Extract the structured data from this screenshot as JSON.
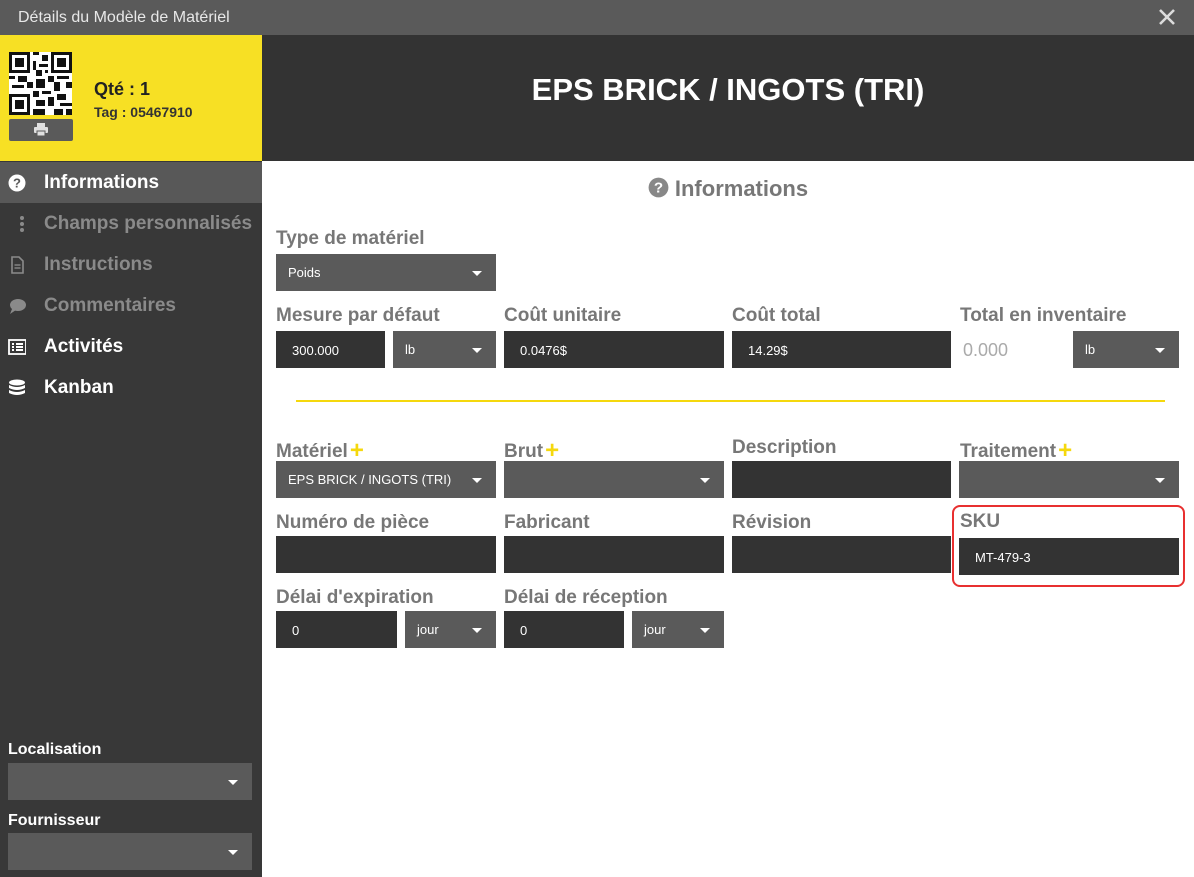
{
  "window": {
    "title": "Détails du Modèle de Matériel"
  },
  "item": {
    "qty": "Qté : 1",
    "tag": "Tag : 05467910",
    "name": "EPS BRICK / INGOTS (TRI)"
  },
  "sidebar": {
    "items": [
      {
        "label": "Informations",
        "icon": "question-circle-icon",
        "state": "active"
      },
      {
        "label": "Champs personnalisés",
        "icon": "vertical-dots-icon",
        "state": "disabled"
      },
      {
        "label": "Instructions",
        "icon": "document-icon",
        "state": "disabled"
      },
      {
        "label": "Commentaires",
        "icon": "comment-icon",
        "state": "disabled"
      },
      {
        "label": "Activités",
        "icon": "list-icon",
        "state": "enabled"
      },
      {
        "label": "Kanban",
        "icon": "database-icon",
        "state": "enabled"
      }
    ],
    "location_label": "Localisation",
    "location_value": "",
    "supplier_label": "Fournisseur",
    "supplier_value": ""
  },
  "section": {
    "title": "Informations"
  },
  "form": {
    "type_label": "Type de matériel",
    "type_value": "Poids",
    "default_measure_label": "Mesure par défaut",
    "default_measure_value": "300.000",
    "default_measure_unit": "lb",
    "unit_cost_label": "Coût unitaire",
    "unit_cost_value": "0.0476$",
    "total_cost_label": "Coût total",
    "total_cost_value": "14.29$",
    "inventory_label": "Total en inventaire",
    "inventory_value": "0.000",
    "inventory_unit": "lb",
    "material_label": "Matériel",
    "material_value": "EPS BRICK / INGOTS (TRI)",
    "raw_label": "Brut",
    "raw_value": "",
    "description_label": "Description",
    "description_value": "",
    "treatment_label": "Traitement",
    "treatment_value": "",
    "part_number_label": "Numéro de pièce",
    "part_number_value": "",
    "manufacturer_label": "Fabricant",
    "manufacturer_value": "",
    "revision_label": "Révision",
    "revision_value": "",
    "sku_label": "SKU",
    "sku_value": "MT-479-3",
    "expiry_label": "Délai d'expiration",
    "expiry_value": "0",
    "expiry_unit": "jour",
    "reception_label": "Délai de réception",
    "reception_value": "0",
    "reception_unit": "jour"
  },
  "colors": {
    "accent_yellow": "#f7e024",
    "header_dark": "#333333",
    "sidebar_bg": "#383838",
    "highlight_red": "#e83030"
  }
}
